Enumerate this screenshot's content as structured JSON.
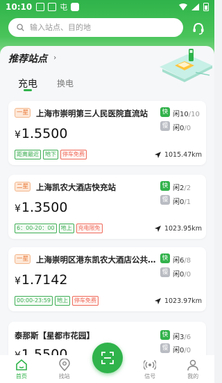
{
  "status_bar": {
    "time": "10:10",
    "app_glyph": "屯"
  },
  "search": {
    "placeholder": "输入站点、目的地"
  },
  "section": {
    "title": "推荐站点",
    "arrow": "›"
  },
  "tabs": [
    {
      "label": "充电"
    },
    {
      "label": "换电"
    }
  ],
  "colors": {
    "primary": "#2fb34a",
    "orange": "#e97a3a",
    "red": "#ef6b5b"
  },
  "stations": [
    {
      "tier": "一星",
      "name": "上海市崇明第三人民医院直流站",
      "price": "1.5500",
      "yen": "¥",
      "tags": [
        {
          "text": "距离最近",
          "color": "green"
        },
        {
          "text": "地下",
          "color": "green"
        },
        {
          "text": "停车免费",
          "color": "red"
        }
      ],
      "fast": {
        "label": "快",
        "prefix": "闲",
        "free": "10",
        "total": "/10"
      },
      "slow": {
        "label": "慢",
        "prefix": "闲",
        "free": "0",
        "total": "/0"
      },
      "distance": "1015.47km"
    },
    {
      "tier": "二星",
      "name": "上海凯农大酒店快充站",
      "price": "1.3500",
      "yen": "¥",
      "tags": [
        {
          "text": "6：00-20：00",
          "color": "green"
        },
        {
          "text": "地上",
          "color": "green"
        },
        {
          "text": "充电限免",
          "color": "red"
        }
      ],
      "fast": {
        "label": "快",
        "prefix": "闲",
        "free": "2",
        "total": "/2"
      },
      "slow": {
        "label": "慢",
        "prefix": "闲",
        "free": "0",
        "total": "/1"
      },
      "distance": "1023.95km"
    },
    {
      "tier": "一星",
      "name": "上海崇明区港东凯农大酒店公共…",
      "price": "1.7142",
      "yen": "¥",
      "tags": [
        {
          "text": "00:00-23:59",
          "color": "green"
        },
        {
          "text": "地上",
          "color": "green"
        },
        {
          "text": "停车免费",
          "color": "red"
        }
      ],
      "fast": {
        "label": "快",
        "prefix": "闲",
        "free": "6",
        "total": "/8"
      },
      "slow": {
        "label": "慢",
        "prefix": "闲",
        "free": "0",
        "total": "/0"
      },
      "distance": "1023.97km"
    },
    {
      "tier": "",
      "name": "泰那斯【星都市花园】",
      "price": "1.5500",
      "yen": "¥",
      "tags": [],
      "fast": {
        "label": "快",
        "prefix": "闲",
        "free": "3",
        "total": "/6"
      },
      "slow": {
        "label": "慢",
        "prefix": "闲",
        "free": "0",
        "total": "/0"
      },
      "distance": ""
    }
  ],
  "nav": [
    {
      "label": "首页",
      "icon": "home-icon"
    },
    {
      "label": "找站",
      "icon": "location-icon"
    },
    {
      "label": "扫码",
      "icon": "scan-icon"
    },
    {
      "label": "信号",
      "icon": "signal-icon"
    },
    {
      "label": "我的",
      "icon": "user-icon"
    }
  ]
}
